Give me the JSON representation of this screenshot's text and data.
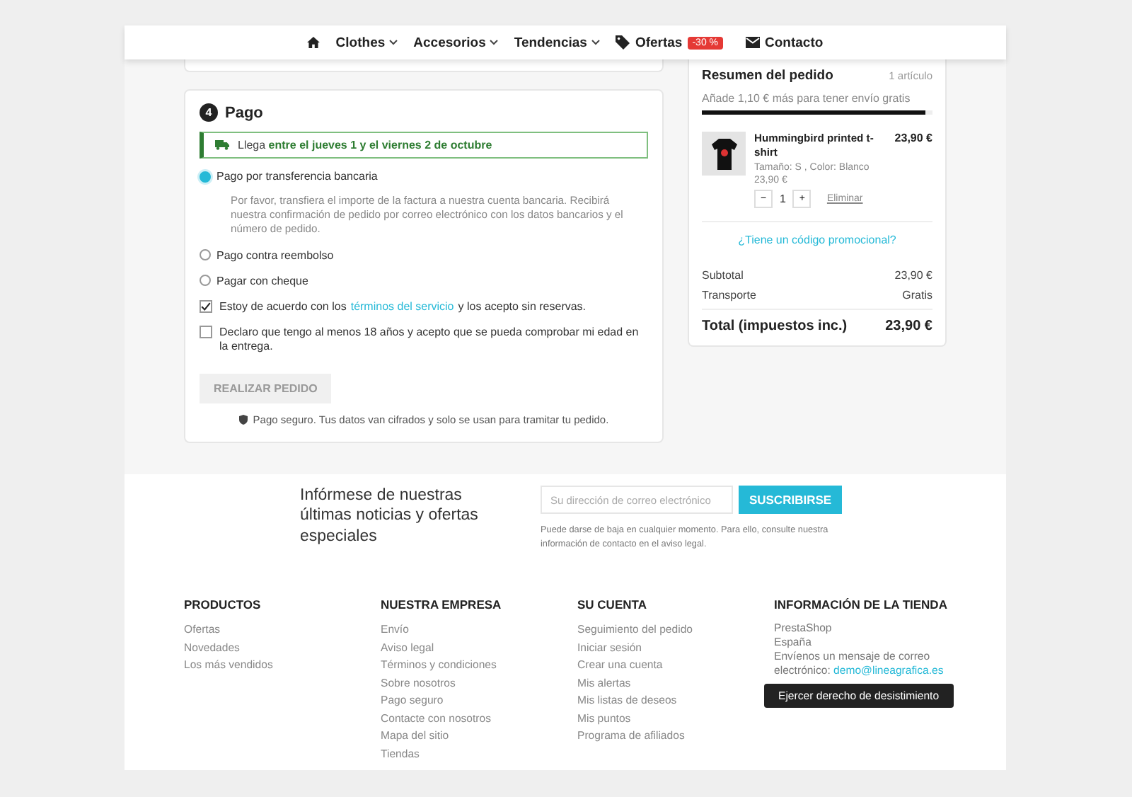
{
  "nav": [
    {
      "kind": "home"
    },
    {
      "kind": "menu",
      "label": "Clothes"
    },
    {
      "kind": "menu",
      "label": "Accesorios"
    },
    {
      "kind": "menu",
      "label": "Tendencias"
    },
    {
      "kind": "offer",
      "label": "Ofertas",
      "badge": "-30 %"
    },
    {
      "kind": "contact",
      "label": "Contacto"
    }
  ],
  "payment": {
    "step": "4",
    "title": "Pago",
    "delivery": "Llega **entre el jueves 1 y el viernes 2 de octubre**",
    "options": [
      {
        "label": "Pago por transferencia bancaria",
        "selected": true,
        "description": "Por favor, transfiera el importe de la factura a nuestra cuenta bancaria. Recibirá nuestra confirmación de pedido por correo electrónico con los datos bancarios y el número de pedido."
      },
      {
        "label": "Pago contra reembolso",
        "selected": false
      },
      {
        "label": "Pagar con cheque",
        "selected": false
      }
    ],
    "conditions": [
      {
        "text": "Estoy de acuerdo con los",
        "link": "términos del servicio",
        "text_after": "y los acepto sin reservas.",
        "checked": true
      },
      {
        "text": "Declaro que tengo al menos 18 años y acepto que se pueda comprobar mi edad en la entrega.",
        "checked": false
      }
    ],
    "button": {
      "label": "REALIZAR PEDIDO",
      "disabled": true
    },
    "secure_note": "Pago seguro. Tus datos van cifrados y solo se usan para tramitar tu pedido."
  },
  "summary": {
    "title": "Resumen del pedido",
    "count": "1 artículo",
    "free_shipping": "Añade 1,10 € más para tener envío gratis",
    "free_shipping_bar": {
      "level": 0.97
    },
    "items": [
      {
        "name": "Hummingbird printed t-shirt",
        "total": "23,90 €",
        "attributes": "Tamaño: S , Color: Blanco",
        "price": "23,90 €",
        "quantity": "1",
        "minus": "−",
        "plus": "+",
        "remove": "Eliminar"
      }
    ],
    "promo": "¿Tiene un código promocional?",
    "lines": [
      {
        "label": "Subtotal",
        "value": "23,90 €"
      },
      {
        "label": "Transporte",
        "value": "Gratis"
      }
    ],
    "total": {
      "label": "Total (impuestos inc.)",
      "value": "23,90 €"
    }
  },
  "newsletter": {
    "heading": "Infórmese de nuestras últimas noticias y ofertas especiales",
    "placeholder": "Su dirección de correo electrónico",
    "button": "SUSCRIBIRSE",
    "note": "Puede darse de baja en cualquier momento. Para ello, consulte nuestra información de contacto en el aviso legal."
  },
  "footer": [
    {
      "title": "PRODUCTOS",
      "links": [
        "Ofertas",
        "Novedades",
        "Los más vendidos"
      ]
    },
    {
      "title": "NUESTRA EMPRESA",
      "links": [
        "Envío",
        "Aviso legal",
        "Términos y condiciones",
        "Sobre nosotros",
        "Pago seguro",
        "Contacte con nosotros",
        "Mapa del sitio",
        "Tiendas"
      ]
    },
    {
      "title": "SU CUENTA",
      "links": [
        "Seguimiento del pedido",
        "Iniciar sesión",
        "Crear una cuenta",
        "Mis alertas",
        "Mis listas de deseos",
        "Mis puntos",
        "Programa de afiliados"
      ]
    }
  ],
  "store_info": {
    "title": "INFORMACIÓN DE LA TIENDA",
    "lines": [
      "PrestaShop",
      "España"
    ],
    "message": "Envíenos un mensaje de correo electrónico:",
    "email": "demo@lineagrafica.es",
    "button": "Ejercer derecho de desistimiento"
  }
}
